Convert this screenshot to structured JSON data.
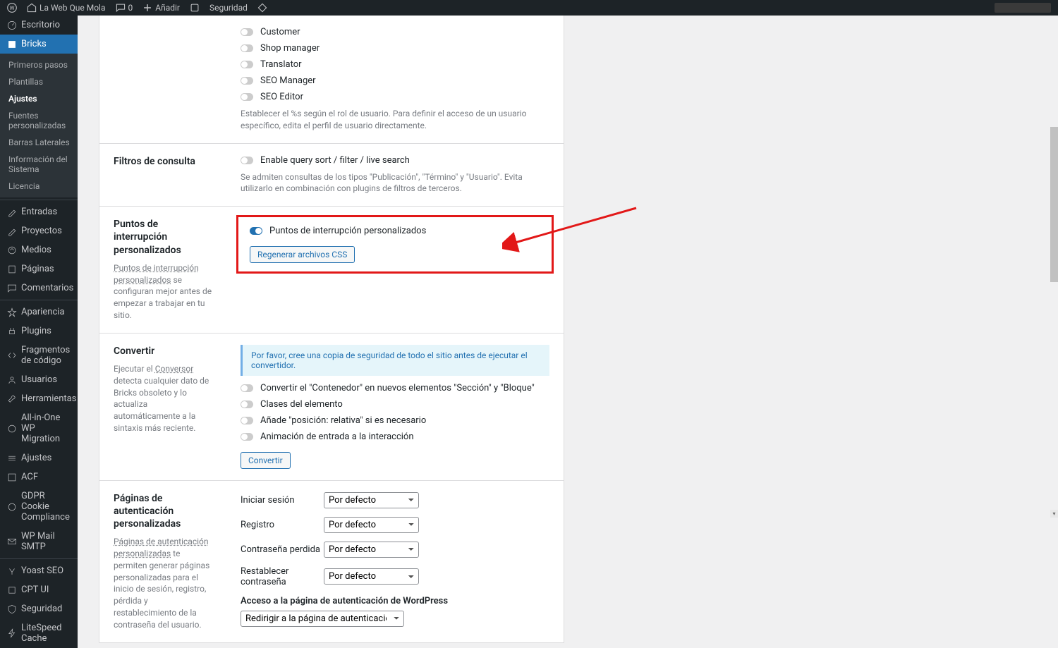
{
  "adminbar": {
    "site": "La Web Que Mola",
    "comments": "0",
    "add": "Añadir",
    "security": "Seguridad"
  },
  "menu": {
    "dashboard": "Escritorio",
    "bricks": "Bricks",
    "sub": {
      "primeros": "Primeros pasos",
      "plantillas": "Plantillas",
      "ajustes": "Ajustes",
      "fuentes": "Fuentes personalizadas",
      "barras": "Barras Laterales",
      "info": "Información del Sistema",
      "licencia": "Licencia"
    },
    "entradas": "Entradas",
    "proyectos": "Proyectos",
    "medios": "Medios",
    "paginas": "Páginas",
    "comentarios": "Comentarios",
    "apariencia": "Apariencia",
    "plugins": "Plugins",
    "fragmentos": "Fragmentos de código",
    "usuarios": "Usuarios",
    "herramientas": "Herramientas",
    "allinone": "All-in-One WP Migration",
    "ajustes": "Ajustes",
    "acf": "ACF",
    "gdpr": "GDPR Cookie Compliance",
    "wpmail": "WP Mail SMTP",
    "yoast": "Yoast SEO",
    "cptui": "CPT UI",
    "seguridad": "Seguridad",
    "litespeed": "LiteSpeed Cache"
  },
  "roles": {
    "customer": "Customer",
    "shopmanager": "Shop manager",
    "translator": "Translator",
    "seomanager": "SEO Manager",
    "seoeditor": "SEO Editor",
    "help": "Establecer el %s según el rol de usuario. Para definir el acceso de un usuario específico, edita el perfil de usuario directamente."
  },
  "filtros": {
    "title": "Filtros de consulta",
    "enable": "Enable query sort / filter / live search",
    "help": "Se admiten consultas de los tipos \"Publicación\", \"Término\" y \"Usuario\". Evita utilizarlo en combinación con plugins de filtros de terceros."
  },
  "breakpoints": {
    "title": "Puntos de interrupción personalizados",
    "desc_link": "Puntos de interrupción personalizados",
    "desc_rest": " se configuran mejor antes de empezar a trabajar en tu sitio.",
    "toggle": "Puntos de interrupción personalizados",
    "btn": "Regenerar archivos CSS"
  },
  "convertir": {
    "title": "Convertir",
    "desc1": "Ejecutar el ",
    "desc_link": "Conversor",
    "desc2": " detecta cualquier dato de Bricks obsoleto y lo actualiza automáticamente a la sintaxis más reciente.",
    "notice": "Por favor, cree una copia de seguridad de todo el sitio antes de ejecutar el convertidor.",
    "opt1": "Convertir el \"Contenedor\" en nuevos elementos \"Sección\" y \"Bloque\"",
    "opt2": "Clases del elemento",
    "opt3": "Añade \"posición: relativa\" si es necesario",
    "opt4": "Animación de entrada a la interacción",
    "btn": "Convertir"
  },
  "auth": {
    "title": "Páginas de autenticación personalizadas",
    "desc_link": "Páginas de autenticación personalizadas",
    "desc_rest": " te permiten generar páginas personalizadas para el inicio de sesión, registro, pérdida y restablecimiento de la contraseña del usuario.",
    "login": "Iniciar sesión",
    "registro": "Registro",
    "lost": "Contraseña perdida",
    "reset": "Restablecer contraseña",
    "default": "Por defecto",
    "acceso": "Acceso a la página de autenticación de WordPress",
    "redirect": "Redirigir a la página de autenticación personalizada"
  }
}
